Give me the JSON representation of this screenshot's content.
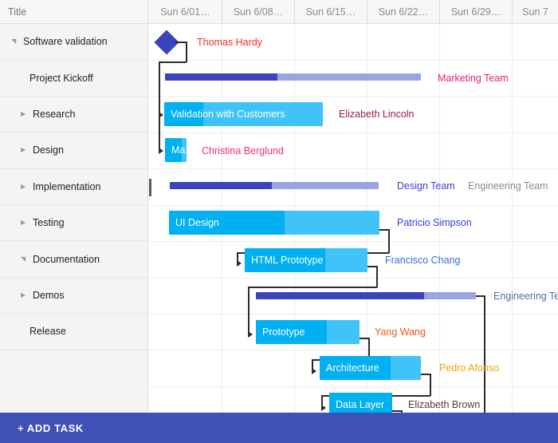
{
  "grid": {
    "title_column_header": "Title",
    "date_columns": [
      "Sun 6/01…",
      "Sun 6/08…",
      "Sun 6/15…",
      "Sun 6/22…",
      "Sun 6/29…",
      "Sun 7"
    ]
  },
  "tasks": [
    {
      "label": "Software validation",
      "level": 0,
      "toggle": "collapse",
      "expanded": true
    },
    {
      "label": "Project Kickoff",
      "level": 2,
      "toggle": "none",
      "expanded": false
    },
    {
      "label": "Research",
      "level": 1,
      "toggle": "expand",
      "expanded": false
    },
    {
      "label": "Design",
      "level": 1,
      "toggle": "expand",
      "expanded": false
    },
    {
      "label": "Implementation",
      "level": 1,
      "toggle": "expand",
      "expanded": false
    },
    {
      "label": "Testing",
      "level": 1,
      "toggle": "expand",
      "expanded": false
    },
    {
      "label": "Documentation",
      "level": 1,
      "toggle": "collapse",
      "expanded": true
    },
    {
      "label": "Demos",
      "level": 1,
      "toggle": "expand",
      "expanded": false
    },
    {
      "label": "Release",
      "level": 2,
      "toggle": "none",
      "expanded": false
    }
  ],
  "bars": [
    {
      "row": 0,
      "kind": "milestone",
      "label": "",
      "assignee": "Thomas Hardy",
      "assignee_color": "#f82d1e"
    },
    {
      "row": 1,
      "kind": "summary",
      "label": "",
      "assignee": "Marketing Team",
      "assignee_color": "#e8207a"
    },
    {
      "row": 2,
      "kind": "task",
      "label": "Validation with Customers",
      "assignee": "Elizabeth Lincoln",
      "assignee_color": "#9b1a52"
    },
    {
      "row": 3,
      "kind": "task",
      "label": "Ma",
      "assignee": "Christina Berglund",
      "assignee_color": "#fa2a6a"
    },
    {
      "row": 4,
      "kind": "summary",
      "label": "",
      "assignee": "Design Team",
      "assignee_color": "#3b43bd"
    },
    {
      "row": 5,
      "kind": "task",
      "label": "UI Design",
      "assignee": "Patricio Simpson",
      "assignee_color": "#2b3fe0"
    },
    {
      "row": 6,
      "kind": "task",
      "label": "HTML Prototype",
      "assignee": "Francisco Chang",
      "assignee_color": "#2f6fd8"
    },
    {
      "row": 7,
      "kind": "summary",
      "label": "",
      "assignee": "Engineering Te",
      "assignee_color": "#4a6fa5"
    },
    {
      "row": 8,
      "kind": "task",
      "label": "Prototype",
      "assignee": "Yang Wang",
      "assignee_color": "#f2571b"
    },
    {
      "row": 9,
      "kind": "task",
      "label": "Architecture",
      "assignee": "Pedro Afonso",
      "assignee_color": "#f5a000"
    },
    {
      "row": 10,
      "kind": "task",
      "label": "Data Layer",
      "assignee": "Elizabeth Brown",
      "assignee_color": "#5a3a30"
    }
  ],
  "extra_assignee": {
    "label": "Engineering Team",
    "color": "#8a8a8a"
  },
  "footer": {
    "add_task_label": "+ ADD TASK"
  },
  "colors": {
    "task_bar": "#3fc3f9",
    "task_progress": "#00b0f0",
    "summary_bar": "#9aa4e0",
    "summary_progress": "#3b43bd",
    "milestone": "#3b43bd",
    "footer_bg": "#3f51b5"
  }
}
